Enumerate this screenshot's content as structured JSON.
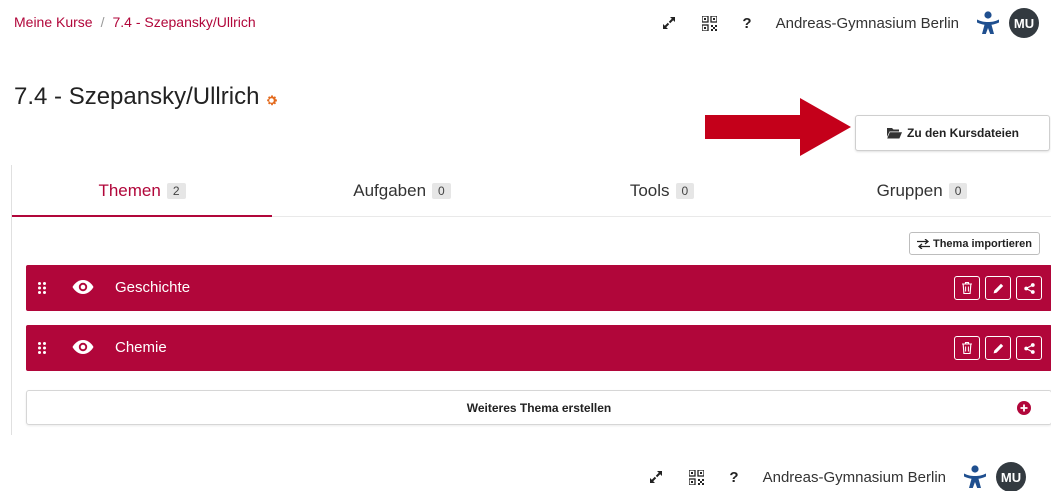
{
  "breadcrumb": {
    "home": "Meine Kurse",
    "separator": "/",
    "current": "7.4 - Szepansky/Ullrich"
  },
  "header": {
    "help": "?",
    "school": "Andreas-Gymnasium Berlin",
    "avatar": "MU",
    "icons": [
      "fullscreen-icon",
      "qr-code-icon",
      "help-icon",
      "school-logo-icon"
    ]
  },
  "page": {
    "title": "7.4 - Szepansky/Ullrich",
    "title_icon": "gear-icon"
  },
  "files_button": {
    "label": "Zu den Kursdateien",
    "icon": "folder-open-icon"
  },
  "tabs": [
    {
      "label": "Themen",
      "count": "2",
      "active": true
    },
    {
      "label": "Aufgaben",
      "count": "0",
      "active": false
    },
    {
      "label": "Tools",
      "count": "0",
      "active": false
    },
    {
      "label": "Gruppen",
      "count": "0",
      "active": false
    }
  ],
  "import_button": {
    "label": "Thema importieren",
    "icon": "exchange-icon"
  },
  "topics": [
    {
      "name": "Geschichte"
    },
    {
      "name": "Chemie"
    }
  ],
  "topic_actions": [
    "trash-icon",
    "pencil-icon",
    "share-icon"
  ],
  "new_topic": {
    "label": "Weiteres Thema erstellen",
    "icon": "plus-circle-icon"
  },
  "footer": {
    "help": "?",
    "school": "Andreas-Gymnasium Berlin",
    "avatar": "MU"
  },
  "colors": {
    "accent": "#b1063a",
    "arrow": "#c4001a",
    "avatar_bg": "#333a40",
    "logo": "#1f4f8f"
  }
}
